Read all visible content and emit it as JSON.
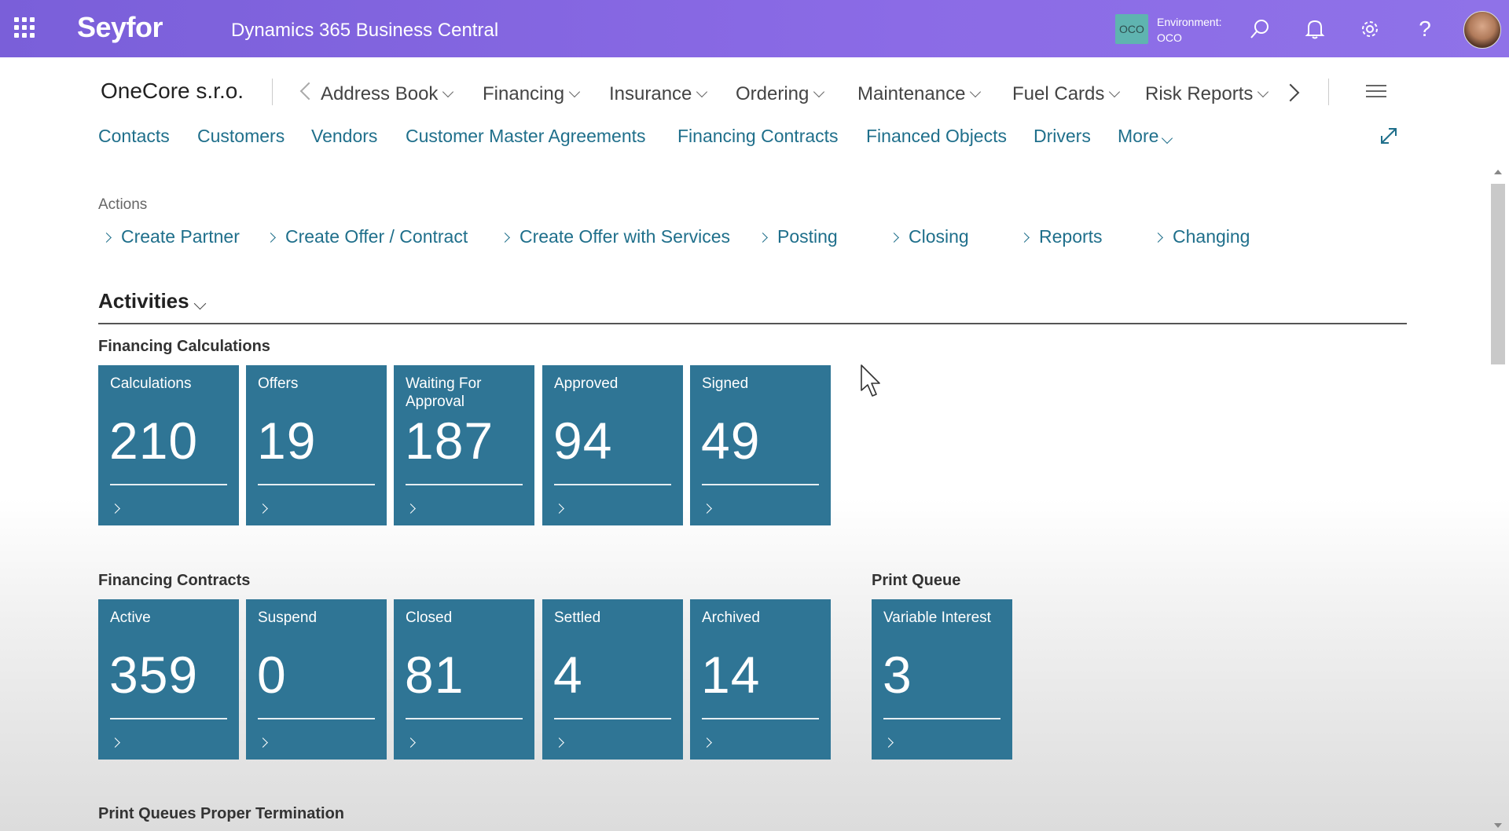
{
  "topbar": {
    "brand": "Seyfor",
    "product": "Dynamics 365 Business Central",
    "environment": {
      "badge": "OCO",
      "label": "Environment:",
      "value": "OCO"
    },
    "icons": [
      "waffle-icon",
      "search-icon",
      "bell-icon",
      "gear-icon",
      "help-icon"
    ]
  },
  "company": "OneCore s.r.o.",
  "nav_menus": [
    "Address Book",
    "Financing",
    "Insurance",
    "Ordering",
    "Maintenance",
    "Fuel Cards",
    "Risk Reports"
  ],
  "links": [
    "Contacts",
    "Customers",
    "Vendors",
    "Customer Master Agreements",
    "Financing Contracts",
    "Financed Objects",
    "Drivers",
    "More"
  ],
  "actions": {
    "label": "Actions",
    "items": [
      "Create Partner",
      "Create Offer / Contract",
      "Create Offer with Services",
      "Posting",
      "Closing",
      "Reports",
      "Changing"
    ]
  },
  "activities": {
    "title": "Activities",
    "groups": [
      {
        "label": "Financing Calculations",
        "tiles": [
          {
            "label": "Calculations",
            "value": "210"
          },
          {
            "label": "Offers",
            "value": "19"
          },
          {
            "label": "Waiting For Approval",
            "value": "187"
          },
          {
            "label": "Approved",
            "value": "94"
          },
          {
            "label": "Signed",
            "value": "49"
          }
        ]
      },
      {
        "label": "Financing Contracts",
        "tiles": [
          {
            "label": "Active",
            "value": "359"
          },
          {
            "label": "Suspend",
            "value": "0"
          },
          {
            "label": "Closed",
            "value": "81"
          },
          {
            "label": "Settled",
            "value": "4"
          },
          {
            "label": "Archived",
            "value": "14"
          }
        ]
      },
      {
        "label": "Print Queue",
        "tiles": [
          {
            "label": "Variable Interest",
            "value": "3"
          }
        ]
      },
      {
        "label": "Print Queues Proper Termination",
        "tiles": []
      }
    ]
  },
  "colors": {
    "topbar": "#8b6be6",
    "tile": "#2f7595",
    "link": "#1f6f8b"
  }
}
